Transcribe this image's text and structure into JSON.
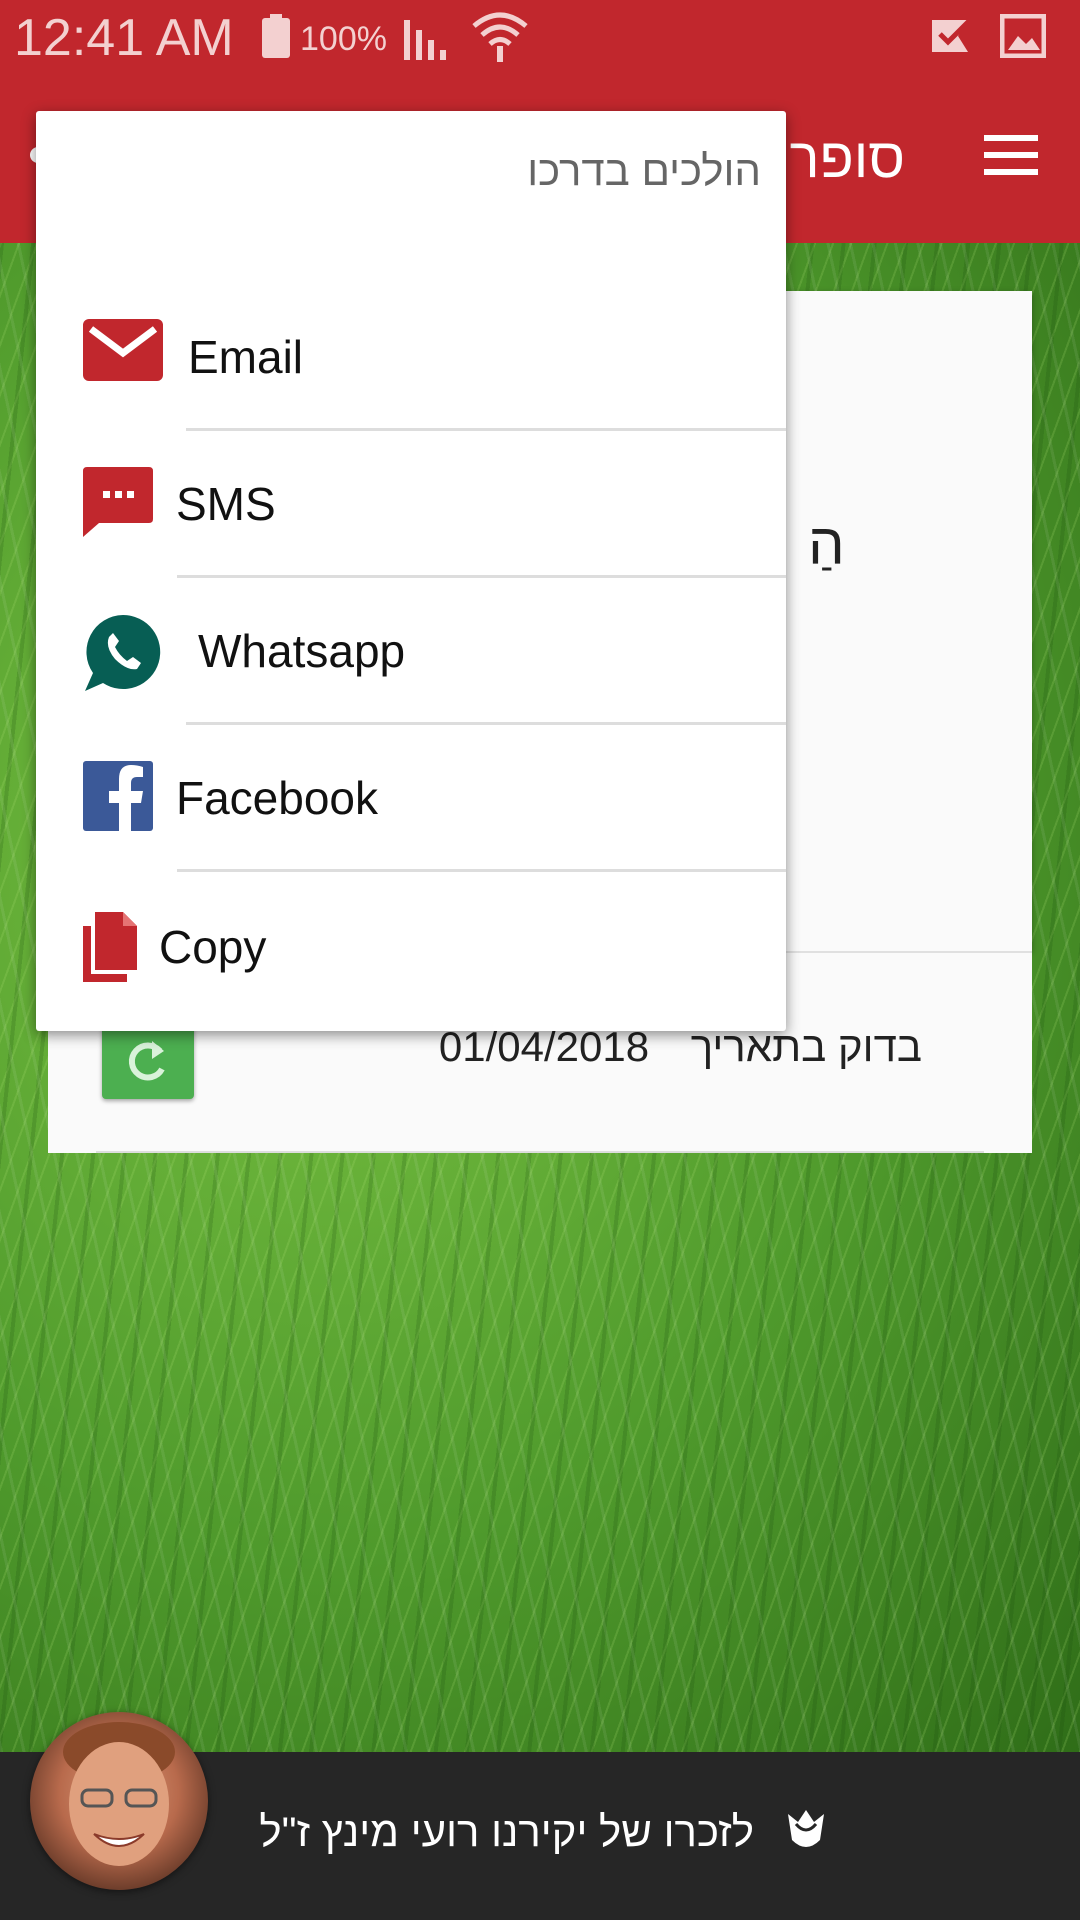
{
  "status_bar": {
    "time": "12:41 AM",
    "battery": "100%"
  },
  "app_bar": {
    "title": "סופר"
  },
  "card": {
    "heading": "הַ",
    "date_label": "בדוק בתאריך",
    "date_value": "01/04/2018"
  },
  "share_menu": {
    "title": "הולכים בדרכו",
    "items": [
      {
        "label": "Email",
        "icon": "email-icon",
        "color": "#c1272d"
      },
      {
        "label": "SMS",
        "icon": "sms-icon",
        "color": "#c1272d"
      },
      {
        "label": "Whatsapp",
        "icon": "whatsapp-icon",
        "color": "#075e54"
      },
      {
        "label": "Facebook",
        "icon": "facebook-icon",
        "color": "#3b5998"
      },
      {
        "label": "Copy",
        "icon": "copy-icon",
        "color": "#c1272d"
      }
    ]
  },
  "bottom_bar": {
    "memorial_text": "לזכרו של יקירנו רועי מינץ ז\"ל"
  },
  "colors": {
    "primary": "#c1272d",
    "refresh_button": "#4caf50",
    "bottom_bar": "#262626"
  }
}
